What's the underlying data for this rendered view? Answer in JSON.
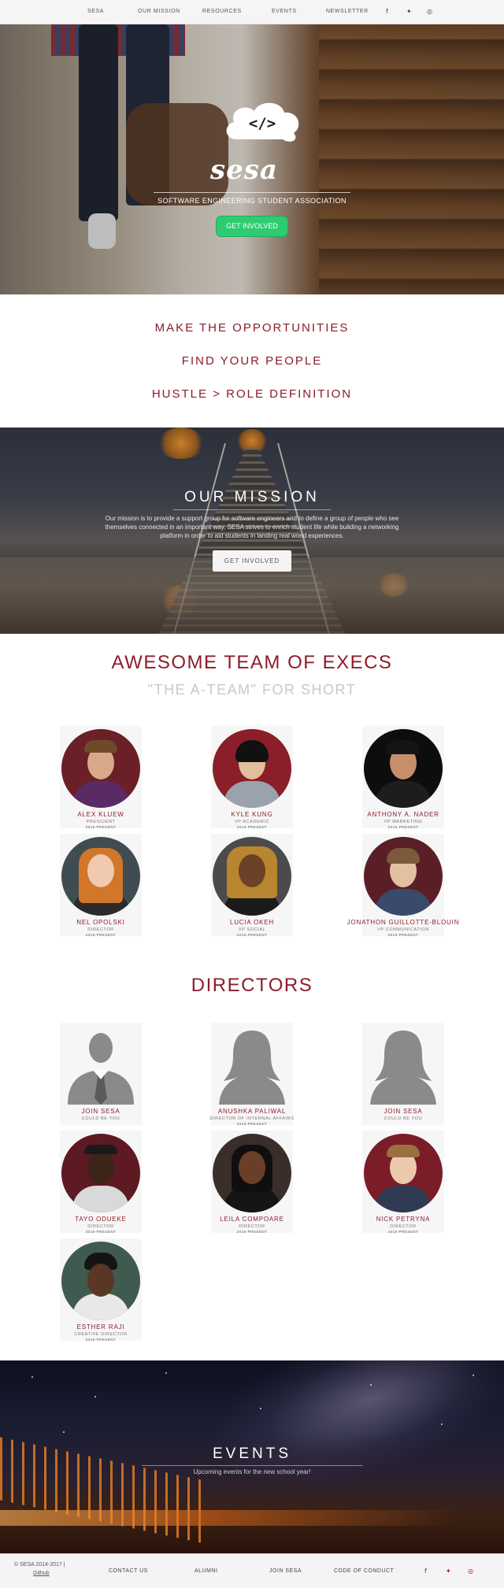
{
  "nav": {
    "items": [
      "SESA",
      "OUR MISSION",
      "RESOURCES",
      "EVENTS",
      "NEWSLETTER"
    ],
    "social": [
      "f",
      "✦",
      "◎"
    ]
  },
  "hero": {
    "logo_code": "</>",
    "logo_word": "sesa",
    "subtitle": "SOFTWARE ENGINEERING STUDENT ASSOCIATION",
    "cta": "GET INVOLVED"
  },
  "taglines": [
    "MAKE THE OPPORTUNITIES",
    "FIND YOUR PEOPLE",
    "HUSTLE > ROLE DEFINITION"
  ],
  "mission": {
    "title": "OUR MISSION",
    "text": "Our mission is to provide a support group for software engineers and to define a group of people who see themselves connected in an important way. SESA strives to enrich student life while building a networking platform in order to aid students in landing real world experiences.",
    "cta": "GET INVOLVED"
  },
  "execs": {
    "title": "AWESOME TEAM OF EXECS",
    "subtitle": "\"THE A-TEAM\" FOR SHORT",
    "people": [
      {
        "name": "ALEX KLUEW",
        "role": "PRESIDENT",
        "years": "2016-PRESENT"
      },
      {
        "name": "KYLE KUNG",
        "role": "VP ACADEMIC",
        "years": "2016-PRESENT"
      },
      {
        "name": "ANTHONY A. NADER",
        "role": "VP MARKETING",
        "years": "2016-PRESENT"
      },
      {
        "name": "NEL OPOLSKI",
        "role": "DIRECTOR",
        "years": "2016-PRESENT"
      },
      {
        "name": "LUCIA OKEH",
        "role": "VP SOCIAL",
        "years": "2016-PRESENT"
      },
      {
        "name": "JONATHON GUILLOTTE-BLOUIN",
        "role": "VP COMMUNICATION",
        "years": "2016-PRESENT"
      }
    ]
  },
  "directors": {
    "title": "DIRECTORS",
    "people": [
      {
        "name": "JOIN SESA",
        "role": "COULD BE YOU",
        "years": ""
      },
      {
        "name": "ANUSHKA PALIWAL",
        "role": "DIRECTOR OF INTERNAL AFFAIRS",
        "years": "2016-PRESENT"
      },
      {
        "name": "JOIN SESA",
        "role": "COULD BE YOU",
        "years": ""
      },
      {
        "name": "TAYO ODUEKE",
        "role": "DIRECTOR",
        "years": "2016-PRESENT"
      },
      {
        "name": "LEILA COMPOARE",
        "role": "DIRECTOR",
        "years": "2016-PRESENT"
      },
      {
        "name": "NICK PETRYNA",
        "role": "DIRECTOR",
        "years": "2016-PRESENT"
      },
      {
        "name": "ESTHER RAJI",
        "role": "CREATIVE DIRECTOR",
        "years": "2016-PRESENT"
      }
    ]
  },
  "events": {
    "title": "EVENTS",
    "subtitle": "Upcoming events for the new school year!"
  },
  "footer": {
    "copyright": "© SESA 2014-2017 |",
    "github": "Github",
    "links": [
      "CONTACT US",
      "ALUMNI",
      "JOIN SESA",
      "CODE OF CONDUCT"
    ],
    "social": [
      "f",
      "✦",
      "◎"
    ]
  },
  "colors": {
    "accent": "#8c1c2b",
    "cta_green": "#2ecc71",
    "muted": "#c8c8c8"
  }
}
